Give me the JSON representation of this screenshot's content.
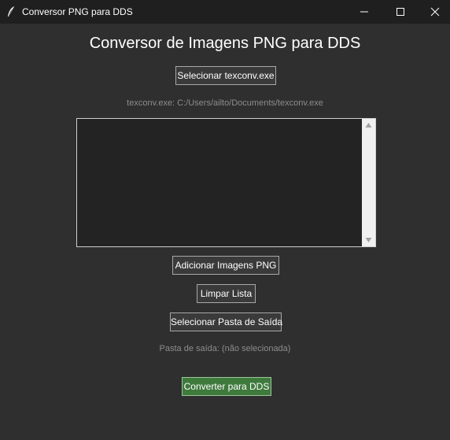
{
  "window": {
    "title": "Conversor PNG para DDS",
    "icon": "feather-icon"
  },
  "controls": {
    "minimize_icon": "minimize-icon",
    "maximize_icon": "maximize-icon",
    "close_icon": "close-icon"
  },
  "main": {
    "heading": "Conversor de Imagens PNG para DDS",
    "select_texconv_label": "Selecionar texconv.exe",
    "texconv_path_text": "texconv.exe: C:/Users/ailto/Documents/texconv.exe",
    "image_list": {
      "items": [],
      "scrollbar": true
    },
    "add_png_label": "Adicionar Imagens PNG",
    "clear_list_label": "Limpar Lista",
    "select_output_label": "Selecionar Pasta de Saída",
    "output_path_text": "Pasta de saída: (não selecionada)",
    "convert_label": "Converter para DDS"
  },
  "colors": {
    "background": "#2f2f2f",
    "titlebar": "#1f1f1f",
    "button": "#3a3a3a",
    "convert_button": "#3f7a3d",
    "muted_text": "#8c8c8c",
    "listbox": "#232323"
  }
}
